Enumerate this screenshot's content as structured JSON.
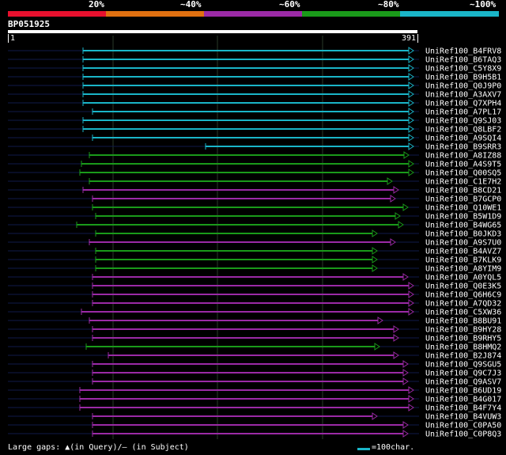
{
  "header": {
    "percent_labels": [
      "20%",
      "~40%",
      "~60%",
      "~80%",
      "~100%"
    ],
    "legend_colors": [
      "#e8102e",
      "#e07010",
      "#9b2aa6",
      "#1a9a1a",
      "#1ab5c8"
    ]
  },
  "query": {
    "name": "BP051925",
    "start": "1",
    "end": "391"
  },
  "hits": [
    {
      "label": "UniRef100_B4FRV8",
      "color": "#1ab5c8",
      "start": 105,
      "end": 523
    },
    {
      "label": "UniRef100_B6TAQ3",
      "color": "#1ab5c8",
      "start": 105,
      "end": 523
    },
    {
      "label": "UniRef100_C5Y8X9",
      "color": "#1ab5c8",
      "start": 105,
      "end": 523
    },
    {
      "label": "UniRef100_B9H5B1",
      "color": "#1ab5c8",
      "start": 105,
      "end": 523
    },
    {
      "label": "UniRef100_Q0J9P0",
      "color": "#1ab5c8",
      "start": 105,
      "end": 523
    },
    {
      "label": "UniRef100_A3AXV7",
      "color": "#1ab5c8",
      "start": 105,
      "end": 523
    },
    {
      "label": "UniRef100_Q7XPH4",
      "color": "#1ab5c8",
      "start": 105,
      "end": 523
    },
    {
      "label": "UniRef100_A7PL17",
      "color": "#1ab5c8",
      "start": 117,
      "end": 523
    },
    {
      "label": "UniRef100_Q9SJ03",
      "color": "#1ab5c8",
      "start": 105,
      "end": 523
    },
    {
      "label": "UniRef100_Q8LBF2",
      "color": "#1ab5c8",
      "start": 105,
      "end": 523
    },
    {
      "label": "UniRef100_A9SQI4",
      "color": "#1ab5c8",
      "start": 117,
      "end": 523
    },
    {
      "label": "UniRef100_B9SRR3",
      "color": "#1ab5c8",
      "start": 260,
      "end": 523
    },
    {
      "label": "UniRef100_A8IZ88",
      "color": "#1a9a1a",
      "start": 113,
      "end": 517
    },
    {
      "label": "UniRef100_A4S9T5",
      "color": "#1a9a1a",
      "start": 103,
      "end": 523
    },
    {
      "label": "UniRef100_Q00SQ5",
      "color": "#1a9a1a",
      "start": 101,
      "end": 523
    },
    {
      "label": "UniRef100_C1E7H2",
      "color": "#1a9a1a",
      "start": 113,
      "end": 496
    },
    {
      "label": "UniRef100_B8CD21",
      "color": "#9b2aa6",
      "start": 105,
      "end": 504
    },
    {
      "label": "UniRef100_B7GCP0",
      "color": "#9b2aa6",
      "start": 117,
      "end": 500
    },
    {
      "label": "UniRef100_Q10WE1",
      "color": "#1a9a1a",
      "start": 117,
      "end": 516
    },
    {
      "label": "UniRef100_B5W1D9",
      "color": "#1a9a1a",
      "start": 121,
      "end": 506
    },
    {
      "label": "UniRef100_B4WG65",
      "color": "#1a9a1a",
      "start": 97,
      "end": 510
    },
    {
      "label": "UniRef100_B0JKD3",
      "color": "#1a9a1a",
      "start": 121,
      "end": 477
    },
    {
      "label": "UniRef100_A9S7U0",
      "color": "#9b2aa6",
      "start": 113,
      "end": 500
    },
    {
      "label": "UniRef100_B4AVZ7",
      "color": "#1a9a1a",
      "start": 121,
      "end": 477
    },
    {
      "label": "UniRef100_B7KLK9",
      "color": "#1a9a1a",
      "start": 121,
      "end": 477
    },
    {
      "label": "UniRef100_A8YIM9",
      "color": "#1a9a1a",
      "start": 121,
      "end": 477
    },
    {
      "label": "UniRef100_A0YQL5",
      "color": "#9b2aa6",
      "start": 117,
      "end": 516
    },
    {
      "label": "UniRef100_Q0E3K5",
      "color": "#9b2aa6",
      "start": 117,
      "end": 523
    },
    {
      "label": "UniRef100_Q6H6C9",
      "color": "#9b2aa6",
      "start": 117,
      "end": 523
    },
    {
      "label": "UniRef100_A7QD32",
      "color": "#9b2aa6",
      "start": 117,
      "end": 523
    },
    {
      "label": "UniRef100_C5XW36",
      "color": "#9b2aa6",
      "start": 103,
      "end": 523
    },
    {
      "label": "UniRef100_B8BU91",
      "color": "#9b2aa6",
      "start": 113,
      "end": 484
    },
    {
      "label": "UniRef100_B9HY28",
      "color": "#9b2aa6",
      "start": 117,
      "end": 504
    },
    {
      "label": "UniRef100_B9RHY5",
      "color": "#9b2aa6",
      "start": 117,
      "end": 504
    },
    {
      "label": "UniRef100_B8HMQ2",
      "color": "#1a9a1a",
      "start": 109,
      "end": 480
    },
    {
      "label": "UniRef100_B2J874",
      "color": "#9b2aa6",
      "start": 137,
      "end": 504
    },
    {
      "label": "UniRef100_Q9SGU5",
      "color": "#9b2aa6",
      "start": 117,
      "end": 516
    },
    {
      "label": "UniRef100_Q9C7J3",
      "color": "#9b2aa6",
      "start": 117,
      "end": 516
    },
    {
      "label": "UniRef100_Q9ASV7",
      "color": "#9b2aa6",
      "start": 117,
      "end": 516
    },
    {
      "label": "UniRef100_B6UD19",
      "color": "#9b2aa6",
      "start": 101,
      "end": 523
    },
    {
      "label": "UniRef100_B4G017",
      "color": "#9b2aa6",
      "start": 101,
      "end": 523
    },
    {
      "label": "UniRef100_B4F7Y4",
      "color": "#9b2aa6",
      "start": 101,
      "end": 523
    },
    {
      "label": "UniRef100_B4VUW3",
      "color": "#9b2aa6",
      "start": 117,
      "end": 477
    },
    {
      "label": "UniRef100_C0PA50",
      "color": "#9b2aa6",
      "start": 117,
      "end": 516
    },
    {
      "label": "UniRef100_C0P8Q3",
      "color": "#9b2aa6",
      "start": 117,
      "end": 516
    }
  ],
  "footer": {
    "left_text": "Large gaps: ▲(in Query)/— (in Subject)",
    "scale_text": "=100char.",
    "scale_color": "#1ab5c8"
  }
}
